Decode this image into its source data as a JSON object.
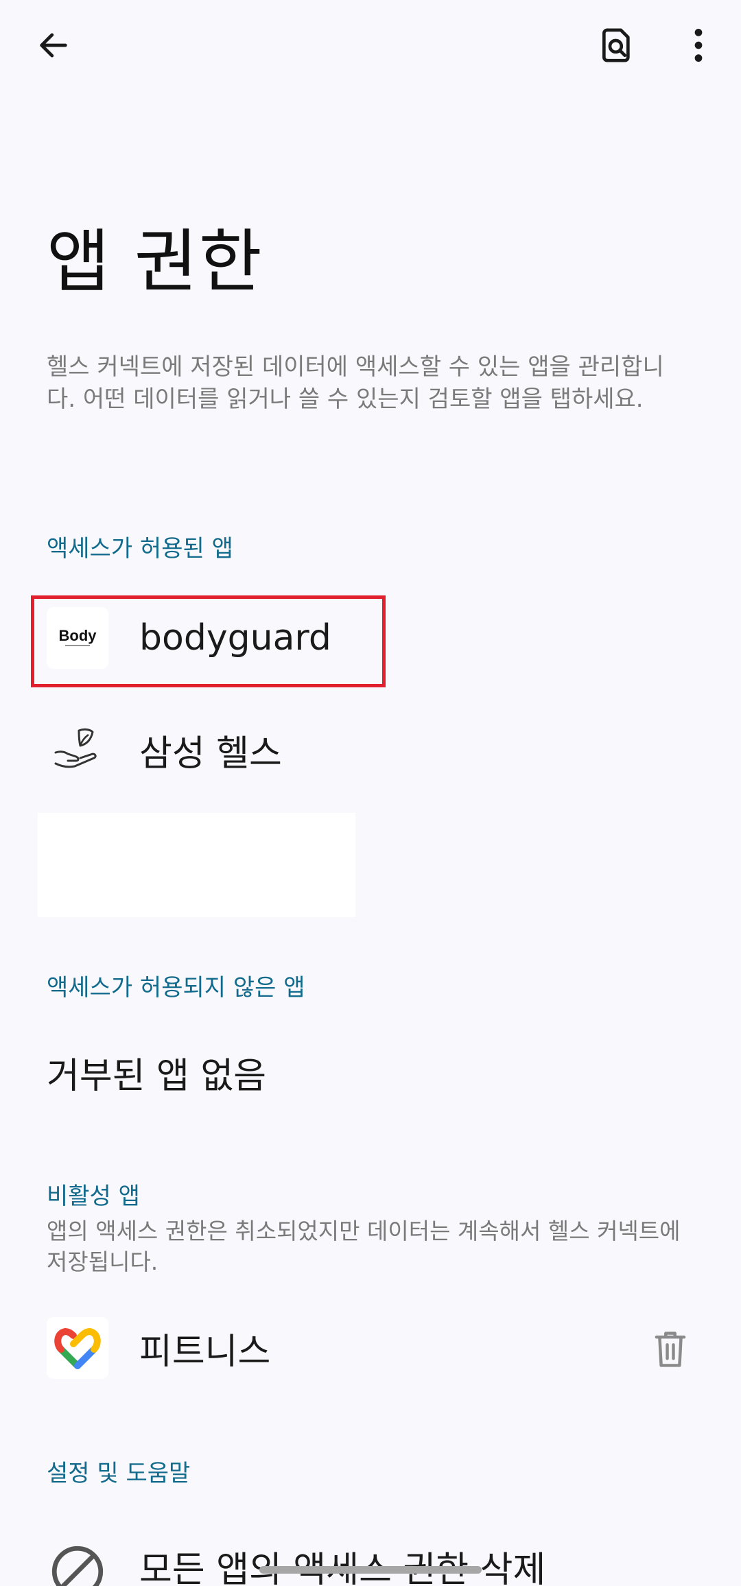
{
  "header": {
    "back_icon": "arrow-left-icon",
    "search_doc_icon": "document-search-icon",
    "more_icon": "more-vertical-icon"
  },
  "page": {
    "title": "앱 권한",
    "description": "헬스 커넥트에 저장된 데이터에 액세스할 수 있는 앱을 관리합니다. 어떤 데이터를 읽거나 쓸 수 있는지 검토할 앱을 탭하세요."
  },
  "allowed": {
    "header": "액세스가 허용된 앱",
    "apps": [
      {
        "name": "bodyguard",
        "icon": "bodyguard-logo-icon",
        "logo_text": "Body"
      },
      {
        "name": "삼성 헬스",
        "icon": "samsung-health-icon"
      }
    ]
  },
  "denied": {
    "header": "액세스가 허용되지 않은 앱",
    "empty_text": "거부된 앱 없음"
  },
  "inactive": {
    "header": "비활성 앱",
    "description": "앱의 액세스 권한은 취소되었지만 데이터는 계속해서 헬스 커넥트에 저장됩니다.",
    "apps": [
      {
        "name": "피트니스",
        "icon": "google-fit-icon",
        "action_icon": "trash-icon"
      }
    ]
  },
  "settings": {
    "header": "설정 및 도움말",
    "items": [
      {
        "label": "모든 앱의 액세스 권한 삭제",
        "icon": "block-icon"
      }
    ]
  },
  "colors": {
    "background": "#f9f9fd",
    "accent": "#126b8c",
    "highlight": "#e0202c",
    "secondary_text": "#7a7a7a"
  }
}
